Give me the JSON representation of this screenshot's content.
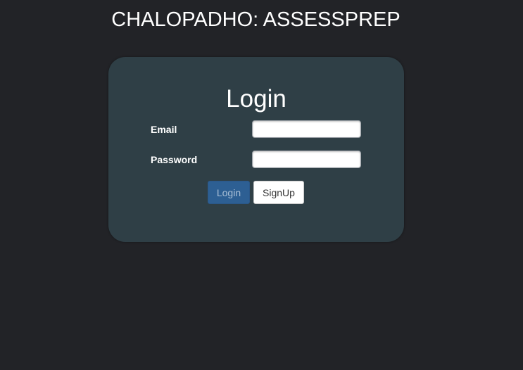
{
  "header": {
    "title": "CHALOPADHO: ASSESSPREP"
  },
  "login_card": {
    "title": "Login",
    "email_label": "Email",
    "email_value": "",
    "password_label": "Password",
    "password_value": "",
    "login_button": "Login",
    "signup_button": "SignUp"
  },
  "colors": {
    "background": "#222327",
    "card": "#2f3f46",
    "primary_button": "#2d5f93"
  }
}
